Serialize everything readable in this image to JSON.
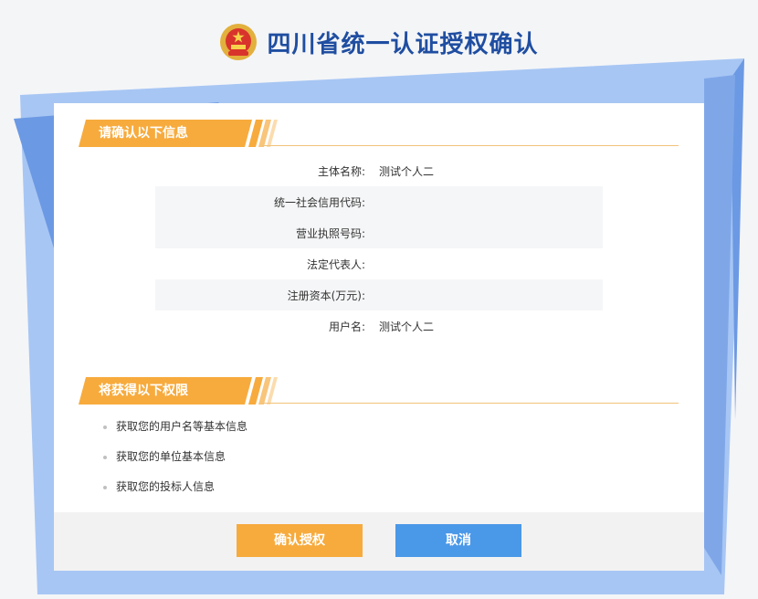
{
  "header": {
    "title": "四川省统一认证授权确认"
  },
  "confirm_section": {
    "heading": "请确认以下信息",
    "rows": [
      {
        "label": "主体名称:",
        "value": "测试个人二"
      },
      {
        "label": "统一社会信用代码:",
        "value": ""
      },
      {
        "label": "营业执照号码:",
        "value": ""
      },
      {
        "label": "法定代表人:",
        "value": ""
      },
      {
        "label": "注册资本(万元):",
        "value": ""
      },
      {
        "label": "用户名:",
        "value": "测试个人二"
      }
    ]
  },
  "permissions_section": {
    "heading": "将获得以下权限",
    "items": [
      "获取您的用户名等基本信息",
      "获取您的单位基本信息",
      "获取您的投标人信息"
    ]
  },
  "actions": {
    "confirm_label": "确认授权",
    "cancel_label": "取消"
  },
  "colors": {
    "title": "#1f4ea1",
    "accent_orange": "#f7ab3d",
    "accent_blue": "#4a98e8",
    "bg_blue_light": "#9dc0f2",
    "bg_blue_dark": "#6a96e3"
  }
}
